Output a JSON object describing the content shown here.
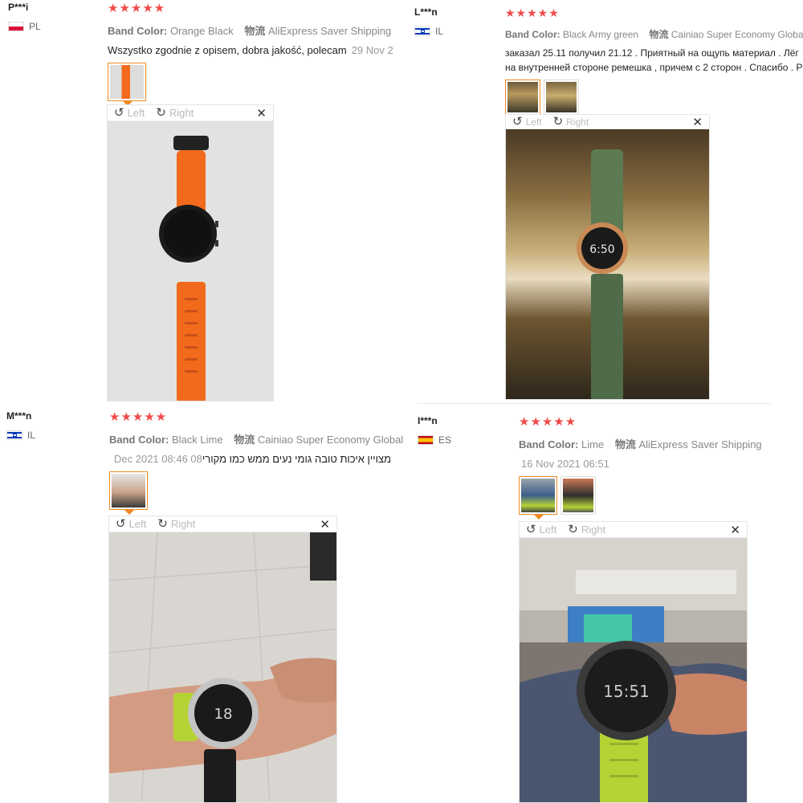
{
  "rotate_left_label": "Left",
  "rotate_right_label": "Right",
  "band_color_label": "Band Color:",
  "logistics_label": "物流",
  "reviews": [
    {
      "name": "P***i",
      "country": "PL",
      "stars": "★★★★★",
      "band_color": "Orange Black",
      "shipping": "AliExpress Saver Shipping",
      "text": "Wszystko zgodnie z opisem, dobra jakość, polecam",
      "date": "29 Nov 2"
    },
    {
      "name": "L***n",
      "country": "IL",
      "stars": "★★★★★",
      "band_color": "Black Army green",
      "shipping": "Cainiao Super Economy Global",
      "text_line1": "заказал 25.11 получил 21.12 . Приятный на ощупь материал . Лёг",
      "text_line2": "на внутренней стороне ремешка , причем с 2 сторон . Спасибо . Р"
    },
    {
      "name": "M***n",
      "country": "IL",
      "stars": "★★★★★",
      "band_color": "Black Lime",
      "shipping": "Cainiao Super Economy Global",
      "text": "מצויין איכות טובה גומי נעים ממש כמו מקורי",
      "date": "08 Dec 2021 08:46"
    },
    {
      "name": "I***n",
      "country": "ES",
      "stars": "★★★★★",
      "band_color": "Lime",
      "shipping": "AliExpress Saver Shipping",
      "date": "16 Nov 2021 06:51"
    }
  ],
  "watch_screens": {
    "review2": "6:50",
    "review3": "18",
    "review4": "15:51"
  },
  "colors": {
    "star": "#f04a4a",
    "accent": "#f08a24",
    "orange_band": "#f26a1b",
    "army_green": "#4f6b4a",
    "lime": "#b5d334"
  }
}
